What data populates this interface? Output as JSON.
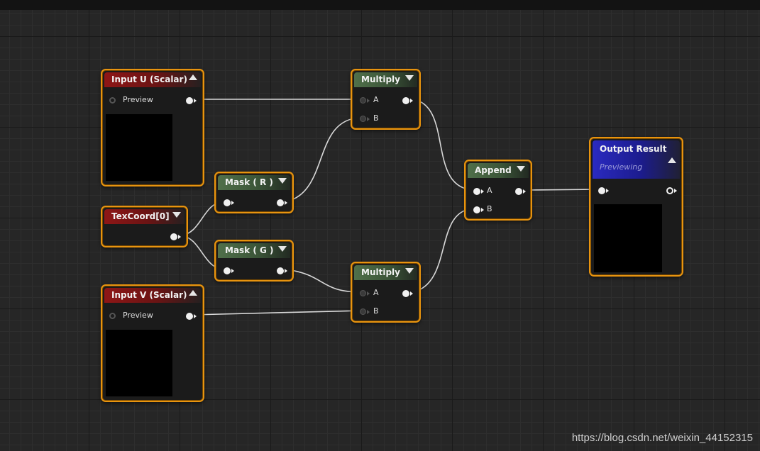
{
  "nodes": {
    "input_u": {
      "title": "Input U (Scalar)",
      "pin_label": "Preview"
    },
    "texcoord": {
      "title": "TexCoord[0]"
    },
    "input_v": {
      "title": "Input V (Scalar)",
      "pin_label": "Preview"
    },
    "mask_r": {
      "title": "Mask ( R )"
    },
    "mask_g": {
      "title": "Mask ( G )"
    },
    "multiply_top": {
      "title": "Multiply",
      "pin_a": "A",
      "pin_b": "B"
    },
    "multiply_bottom": {
      "title": "Multiply",
      "pin_a": "A",
      "pin_b": "B"
    },
    "append": {
      "title": "Append",
      "pin_a": "A",
      "pin_b": "B"
    },
    "output": {
      "title": "Output Result",
      "subtitle": "Previewing"
    }
  },
  "watermark": "https://blog.csdn.net/weixin_44152315",
  "colors": {
    "node_border": "#e8940f",
    "header_red": "#8e1616",
    "header_green": "#50704a",
    "header_blue": "#2a2ac0",
    "wire": "#d8d8d8",
    "grid_bg": "#262626"
  },
  "icons": {
    "collapse_node": "triangle-up-icon",
    "expand_node": "triangle-down-icon",
    "pin": "exec-pin-icon"
  }
}
